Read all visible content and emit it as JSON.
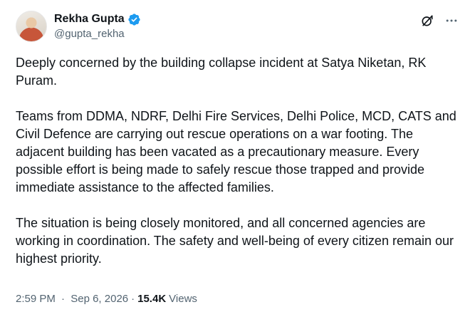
{
  "author": {
    "display_name": "Rekha Gupta",
    "handle": "@gupta_rekha",
    "verified_icon": "verified-badge-icon",
    "avatar": "avatar"
  },
  "actions": {
    "grok_icon": "grok-icon",
    "more_icon": "more-icon"
  },
  "tweet": {
    "paragraphs": [
      "Deeply concerned by the building collapse incident at Satya Niketan, RK Puram.",
      "Teams from DDMA, NDRF, Delhi Fire Services, Delhi Police, MCD, CATS and Civil Defence are carrying out rescue operations on a war footing. The adjacent building has been vacated as a precautionary measure. Every possible effort is being made to safely rescue those trapped and provide immediate assistance to the affected families.",
      "The situation is being closely monitored, and all concerned agencies are working in coordination. The safety and well-being of every citizen remain our highest priority."
    ]
  },
  "meta": {
    "time": "2:59 PM",
    "separator": "·",
    "date": "Sep 6, 2026",
    "views_count": "15.4K",
    "views_label": "Views"
  },
  "colors": {
    "text_primary": "#0f1419",
    "text_secondary": "#536471",
    "verified_blue": "#1d9bf0"
  }
}
